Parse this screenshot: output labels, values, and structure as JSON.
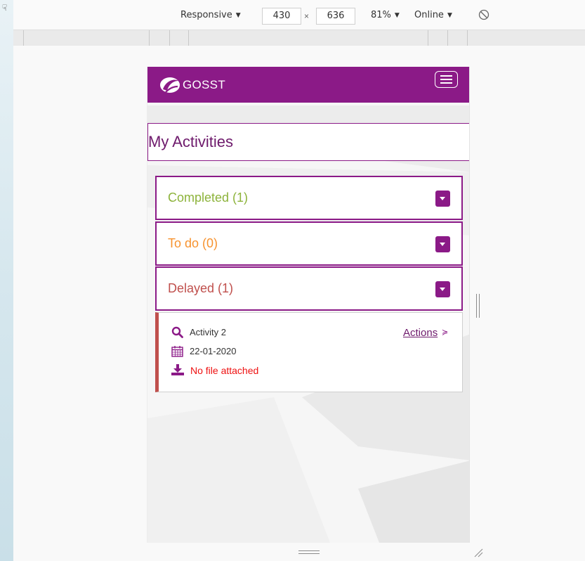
{
  "devtools": {
    "device_mode": "Responsive",
    "width": "430",
    "height_value": "636",
    "dimension_separator": "×",
    "zoom": "81%",
    "throttling": "Online",
    "dropdown_glyph": "▼",
    "cursor_glyph": "☟"
  },
  "app": {
    "brand": "GOSST",
    "header_color": "#8b1a87",
    "page_title": "My Activities"
  },
  "accordion": [
    {
      "label": "Completed (1)",
      "color": "#8db33b"
    },
    {
      "label": "To do (0)",
      "color": "#f7932f"
    },
    {
      "label": "Delayed (1)",
      "color": "#c0504d"
    }
  ],
  "activity": {
    "name": "Activity 2",
    "date": "22-01-2020",
    "file_status": "No file attached",
    "actions_label": "Actions",
    "actions_chevron": "≽",
    "status_color": "#c0504d"
  }
}
